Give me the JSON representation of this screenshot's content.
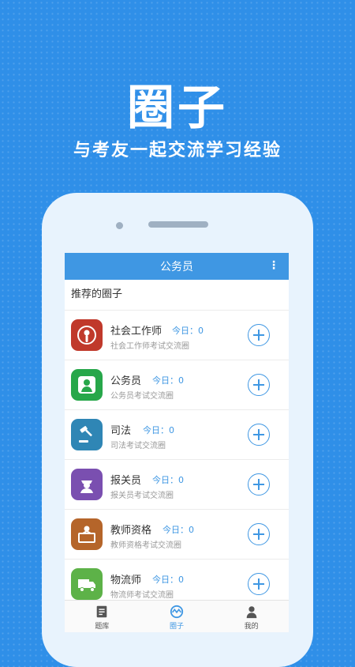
{
  "hero": {
    "logo_text": "圈子",
    "slogan": "与考友一起交流学习经验"
  },
  "appbar": {
    "title": "公务员",
    "menu_icon": "more-vertical-icon"
  },
  "section": {
    "title": "推荐的圈子"
  },
  "circles": [
    {
      "name": "社会工作师",
      "today": "今日：0",
      "desc": "社会工作师考试交流圈",
      "icon": "microphone-icon",
      "color": "#c0392b"
    },
    {
      "name": "公务员",
      "today": "今日：0",
      "desc": "公务员考试交流圈",
      "icon": "official-person-icon",
      "color": "#27a74a"
    },
    {
      "name": "司法",
      "today": "今日：0",
      "desc": "司法考试交流圈",
      "icon": "gavel-icon",
      "color": "#2f86b5"
    },
    {
      "name": "报关员",
      "today": "今日：0",
      "desc": "报关员考试交流圈",
      "icon": "customs-officer-icon",
      "color": "#7a4fb0"
    },
    {
      "name": "教师资格",
      "today": "今日：0",
      "desc": "教师资格考试交流圈",
      "icon": "teacher-desk-icon",
      "color": "#b5652a"
    },
    {
      "name": "物流师",
      "today": "今日：0",
      "desc": "物流师考试交流圈",
      "icon": "truck-icon",
      "color": "#5db248"
    }
  ],
  "tabs": [
    {
      "label": "题库",
      "icon": "book-icon"
    },
    {
      "label": "圈子",
      "icon": "circle-icon"
    },
    {
      "label": "我的",
      "icon": "user-icon"
    }
  ],
  "colors": {
    "background": "#2f8fe8",
    "accent": "#3f97e3"
  }
}
